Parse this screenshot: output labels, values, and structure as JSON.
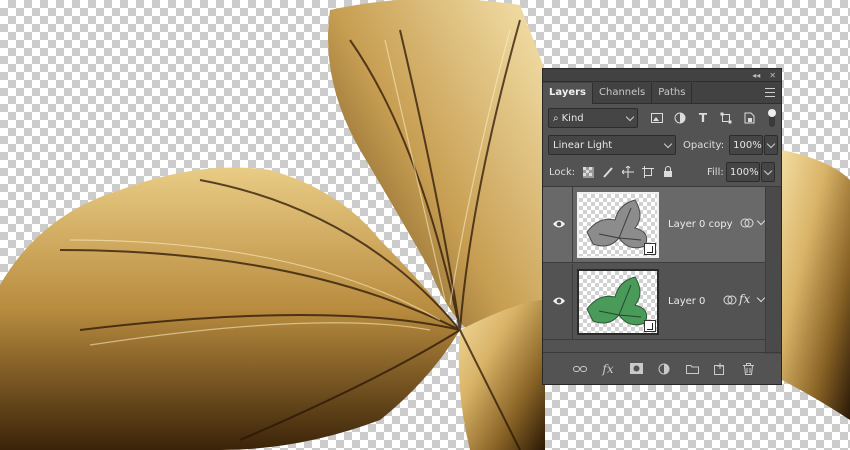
{
  "panel": {
    "titlebar": {
      "collapse_glyph": "◂◂",
      "close_glyph": "✕"
    },
    "tabs": [
      {
        "label": "Layers",
        "active": true
      },
      {
        "label": "Channels",
        "active": false
      },
      {
        "label": "Paths",
        "active": false
      }
    ],
    "filter": {
      "search_glyph": "⌕",
      "value": "Kind",
      "icons": [
        "image-filter-icon",
        "adjustment-filter-icon",
        "type-filter-icon",
        "shape-filter-icon",
        "smart-object-filter-icon"
      ]
    },
    "blend": {
      "value": "Linear Light",
      "opacity_label": "Opacity:",
      "opacity_value": "100%"
    },
    "lock": {
      "label": "Lock:",
      "fill_label": "Fill:",
      "fill_value": "100%"
    },
    "layers": [
      {
        "name": "Layer 0 copy",
        "selected": true,
        "thumb_color": "#8c8c8c"
      },
      {
        "name": "Layer 0",
        "selected": false,
        "thumb_color": "#4a9a5a"
      }
    ],
    "fx_glyph": "fx",
    "type_glyph": "T",
    "bottom_icons": [
      "link-icon",
      "fx-icon",
      "mask-icon",
      "adjustment-icon",
      "folder-icon",
      "new-layer-icon",
      "trash-icon"
    ]
  }
}
